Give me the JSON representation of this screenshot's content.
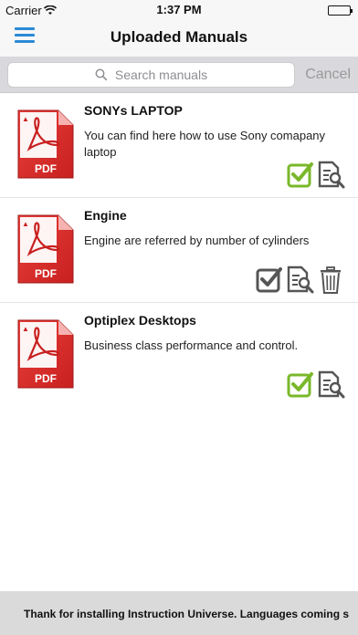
{
  "status": {
    "carrier": "Carrier",
    "time": "1:37 PM"
  },
  "nav": {
    "title": "Uploaded Manuals",
    "menu_icon": "hamburger-icon",
    "accent_color": "#2a8ad6"
  },
  "search": {
    "placeholder": "Search manuals",
    "cancel_label": "Cancel"
  },
  "manuals": [
    {
      "title": "SONYs LAPTOP",
      "description": "You can find here how to use Sony comapany laptop",
      "verified": true,
      "actions": [
        "check-icon",
        "view-document-icon"
      ]
    },
    {
      "title": "Engine",
      "description": "Engine are referred by number of cylinders",
      "verified": false,
      "actions": [
        "check-icon",
        "view-document-icon",
        "trash-icon"
      ]
    },
    {
      "title": "Optiplex Desktops",
      "description": "Business class performance and control.",
      "verified": true,
      "actions": [
        "check-icon",
        "view-document-icon"
      ]
    }
  ],
  "pdf_label": "PDF",
  "colors": {
    "pdf_red": "#c8201f",
    "check_green": "#79b82a",
    "check_gray": "#555555"
  },
  "footer": {
    "text": "Thank for installing Instruction Universe. Languages coming s"
  }
}
